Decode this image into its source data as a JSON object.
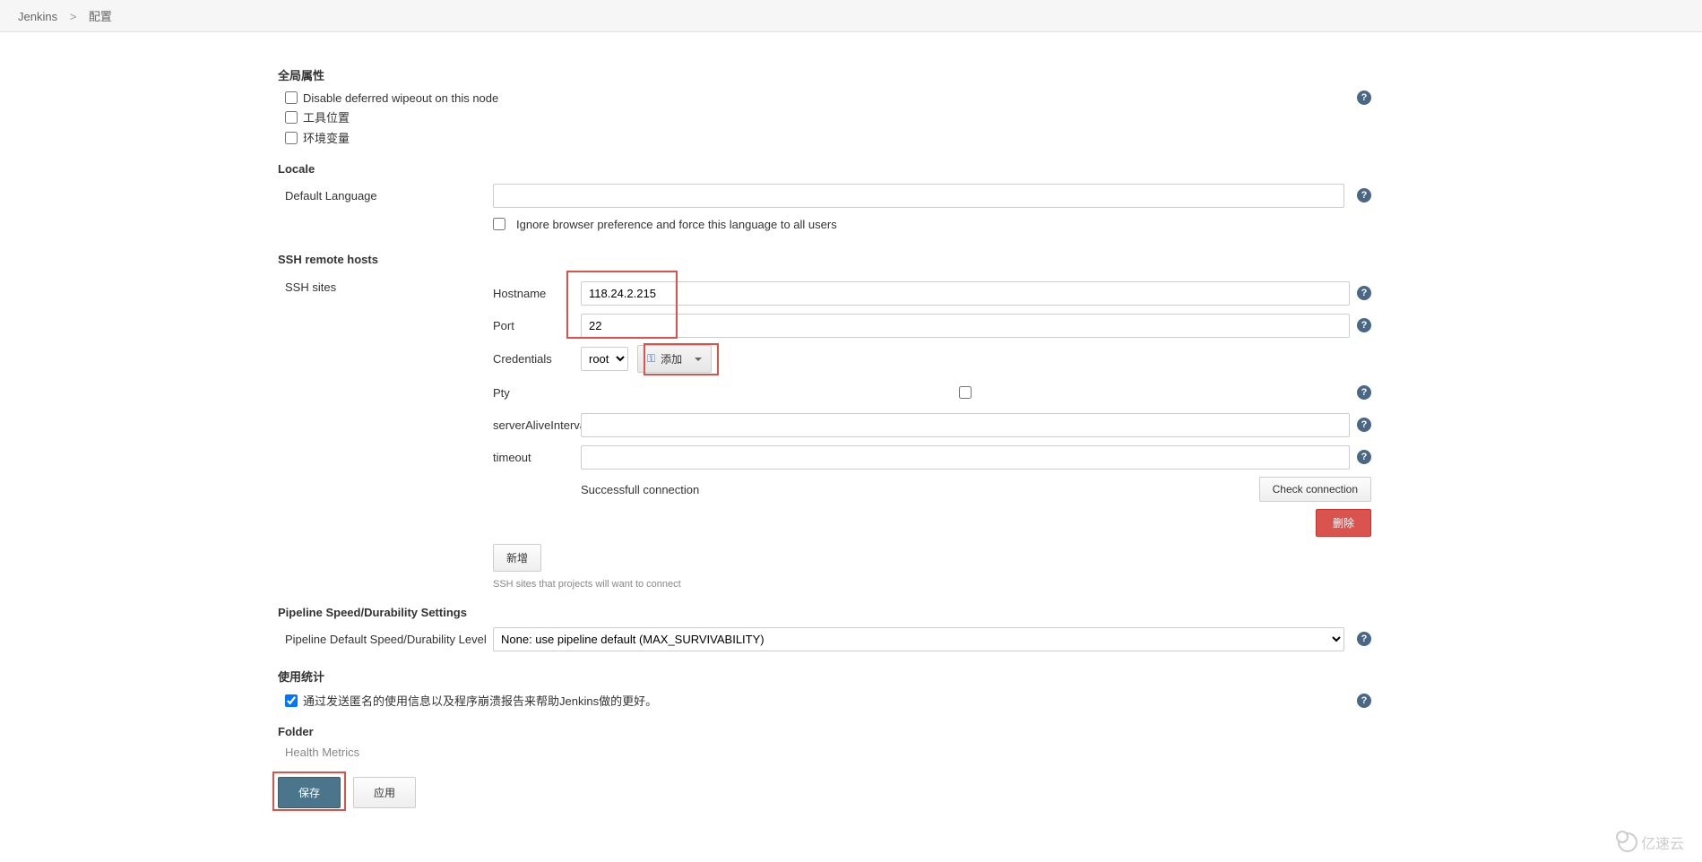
{
  "breadcrumb": {
    "root": "Jenkins",
    "page": "配置",
    "sep": ">"
  },
  "section_global": "全局属性",
  "global": {
    "disable_wipeout": "Disable deferred wipeout on this node",
    "tool_locations": "工具位置",
    "env_vars": "环境变量"
  },
  "section_locale": "Locale",
  "locale": {
    "default_lang_label": "Default Language",
    "default_lang_value": "",
    "ignore_browser": "Ignore browser preference and force this language to all users"
  },
  "section_ssh": "SSH remote hosts",
  "ssh_sites_label": "SSH sites",
  "ssh": {
    "hostname_label": "Hostname",
    "hostname_value": "118.24.2.215",
    "port_label": "Port",
    "port_value": "22",
    "cred_label": "Credentials",
    "cred_value": "root",
    "add_btn": "添加",
    "pty_label": "Pty",
    "sai_label": "serverAliveInterval",
    "sai_value": "",
    "timeout_label": "timeout",
    "timeout_value": "",
    "status": "Successfull connection",
    "check_btn": "Check connection",
    "delete_btn": "删除",
    "new_btn": "新增",
    "desc": "SSH sites that projects will want to connect"
  },
  "section_pipeline": "Pipeline Speed/Durability Settings",
  "pipeline": {
    "label": "Pipeline Default Speed/Durability Level",
    "value": "None: use pipeline default (MAX_SURVIVABILITY)"
  },
  "section_stats": "使用统计",
  "stats": {
    "agree": "通过发送匿名的使用信息以及程序崩溃报告来帮助Jenkins做的更好。"
  },
  "section_folder": "Folder",
  "folder": {
    "health_metrics": "Health Metrics"
  },
  "buttons": {
    "save": "保存",
    "apply": "应用"
  },
  "help_glyph": "?",
  "watermark": "亿速云"
}
